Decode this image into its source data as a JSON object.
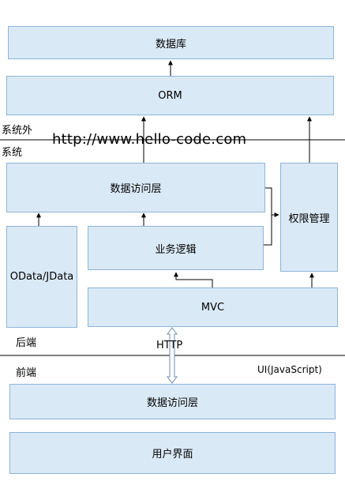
{
  "boxes": {
    "database": "数据库",
    "orm": "ORM",
    "data_access_backend": "数据访问层",
    "permission": "权限管理",
    "odata": "OData/JData",
    "business_logic": "业务逻辑",
    "mvc": "MVC",
    "data_access_frontend": "数据访问层",
    "user_interface": "用户界面"
  },
  "labels": {
    "outside_system": "系统外",
    "system": "系统",
    "backend": "后端",
    "frontend": "前端",
    "http": "HTTP",
    "ui_js": "UI(JavaScript)",
    "watermark": "http://www.hello-code.com"
  }
}
